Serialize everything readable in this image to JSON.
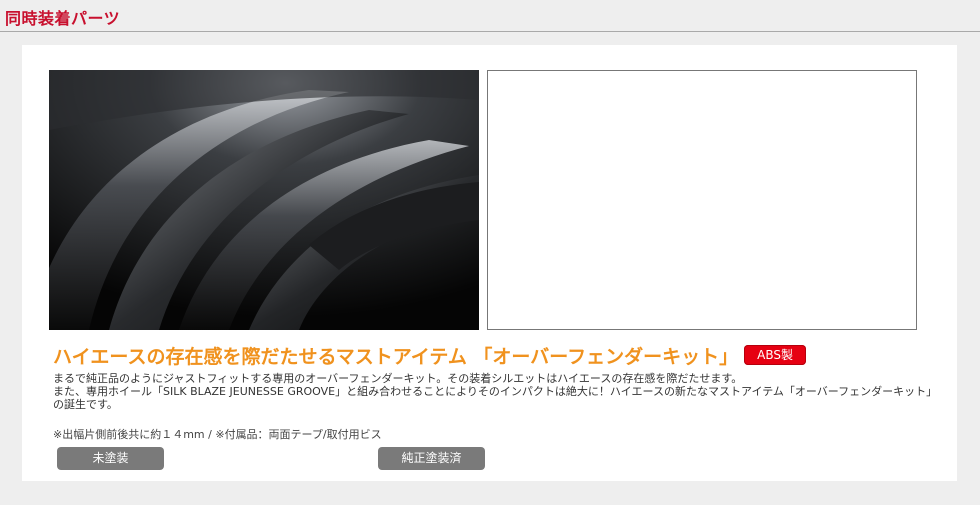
{
  "section": {
    "title": "同時装着パーツ"
  },
  "product": {
    "headline": "ハイエースの存在感を際だたせるマストアイテム 「オーバーフェンダーキット」",
    "material_badge": "ABS製",
    "description_line1": "まるで純正品のようにジャストフィットする専用のオーバーフェンダーキット。その装着シルエットはハイエースの存在感を際だたせます。",
    "description_line2": "また、専用ホイール「SILK BLAZE JEUNESSE GROOVE」と組み合わせることによりそのインパクトは絶大に！ハイエースの新たなマストアイテム「オーバーフェンダーキット」の誕生です。",
    "note": "※出幅片側前後共に約１４mm / ※付属品：両面テープ/取付用ビス"
  },
  "variants": [
    {
      "label": "未塗装"
    },
    {
      "label": "純正塗装済"
    }
  ],
  "colors": {
    "title_red": "#c8102e",
    "headline_orange": "#f0921e",
    "badge_red": "#e60012",
    "button_gray": "#7a7a7a"
  }
}
